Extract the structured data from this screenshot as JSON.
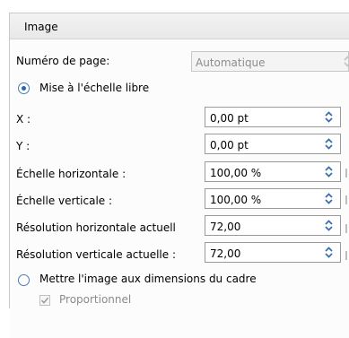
{
  "section": {
    "title": "Image"
  },
  "page_number": {
    "label": "Numéro de page:",
    "value": "Automatique"
  },
  "free_scale": {
    "label": "Mise à l'échelle libre",
    "selected": true
  },
  "fields": [
    {
      "label": "X :",
      "value": "0,00 pt"
    },
    {
      "label": "Y :",
      "value": "0,00 pt"
    },
    {
      "label": "Échelle horizontale :",
      "value": "100,00 %"
    },
    {
      "label": "Échelle verticale :",
      "value": "100,00 %"
    },
    {
      "label": "Résolution horizontale actuell",
      "value": "72,00"
    },
    {
      "label": "Résolution verticale actuelle :",
      "value": "72,00"
    }
  ],
  "fit_frame": {
    "label": "Mettre l'image aux dimensions du cadre",
    "selected": false
  },
  "proportional": {
    "label": "Proportionnel",
    "checked": true,
    "enabled": false
  },
  "colors": {
    "accent": "#2a64b0",
    "border": "#9a9a9a"
  }
}
